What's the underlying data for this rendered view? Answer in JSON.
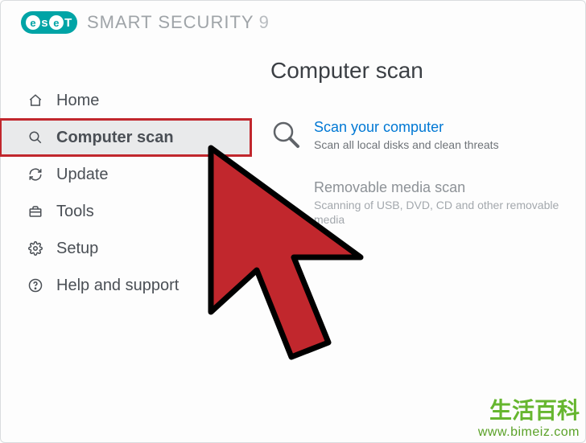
{
  "header": {
    "logo_text": "eseT",
    "product_name": "SMART SECURITY",
    "product_version": "9"
  },
  "sidebar": {
    "items": [
      {
        "id": "home",
        "label": "Home",
        "icon": "home-icon"
      },
      {
        "id": "computer-scan",
        "label": "Computer scan",
        "icon": "search-icon",
        "selected": true,
        "highlighted": true
      },
      {
        "id": "update",
        "label": "Update",
        "icon": "refresh-icon"
      },
      {
        "id": "tools",
        "label": "Tools",
        "icon": "briefcase-icon"
      },
      {
        "id": "setup",
        "label": "Setup",
        "icon": "gear-icon"
      },
      {
        "id": "help",
        "label": "Help and support",
        "icon": "help-icon"
      }
    ]
  },
  "main": {
    "title": "Computer scan",
    "options": [
      {
        "id": "scan-your-computer",
        "title": "Scan your computer",
        "desc": "Scan all local disks and clean threats",
        "primary": true
      },
      {
        "id": "removable-media-scan",
        "title": "Removable media scan",
        "desc": "Scanning of USB, DVD, CD and other removable media",
        "primary": false
      }
    ]
  },
  "watermark": {
    "cn": "生活百科",
    "url": "www.bimeiz.com"
  },
  "overlay": {
    "cursor_color": "#c1272d",
    "highlight_color": "#c1272d"
  }
}
